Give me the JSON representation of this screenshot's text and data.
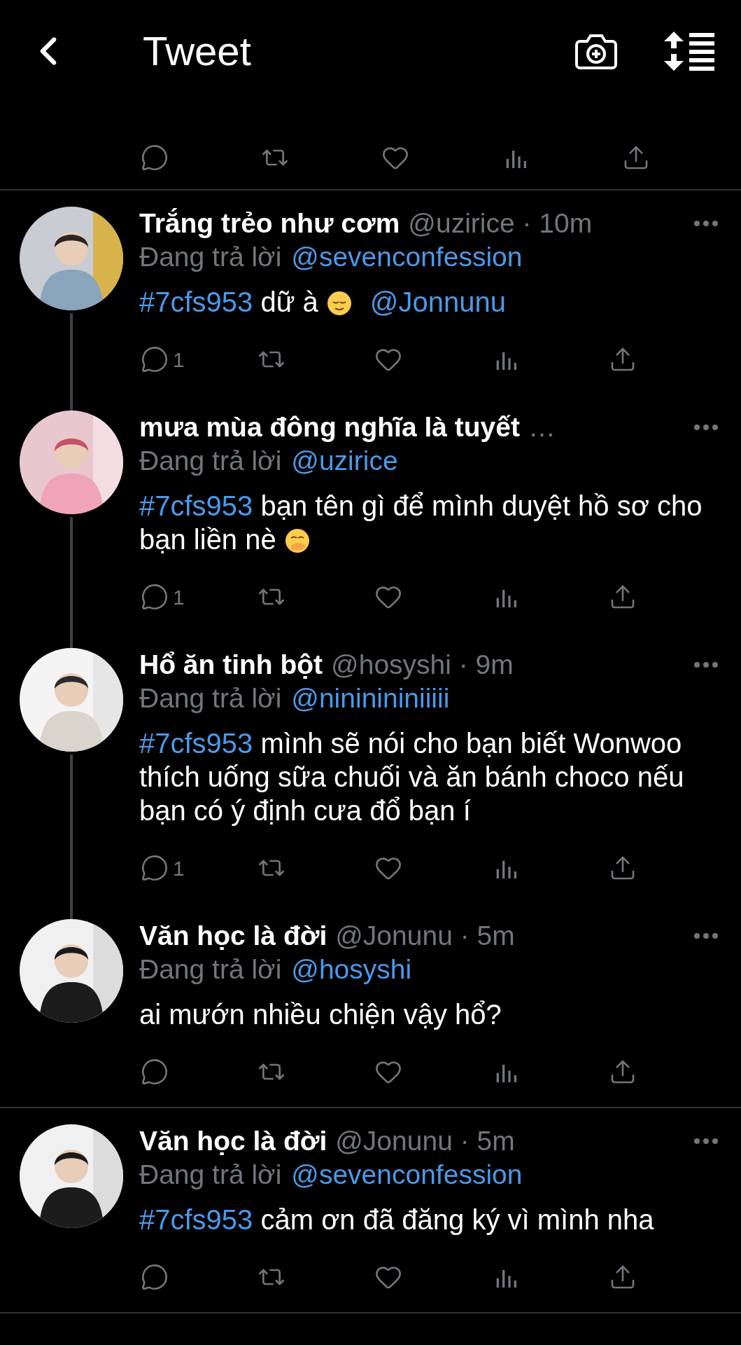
{
  "header": {
    "title": "Tweet"
  },
  "previous_tweet": {
    "actions": [
      {
        "kind": "reply"
      },
      {
        "kind": "retweet"
      },
      {
        "kind": "like"
      },
      {
        "kind": "views"
      },
      {
        "kind": "share"
      }
    ]
  },
  "tweets": [
    {
      "name": "Trắng trẻo như cơm",
      "meta": "@uzirice · 10m",
      "reply_label": "Đang trả lời",
      "reply_to": "@sevenconfession",
      "connects_below": true,
      "body": [
        {
          "kind": "hashtag",
          "text": "#7cfs953"
        },
        {
          "kind": "text",
          "text": " dữ à"
        },
        {
          "kind": "emoji_relieved"
        },
        {
          "kind": "mention",
          "text": "@Jonnunu"
        }
      ],
      "actions": [
        {
          "kind": "reply",
          "count": "1"
        },
        {
          "kind": "retweet"
        },
        {
          "kind": "like"
        },
        {
          "kind": "views"
        },
        {
          "kind": "share"
        }
      ]
    },
    {
      "name": "mưa mùa đông nghĩa là tuyết",
      "meta": "…",
      "reply_label": "Đang trả lời",
      "reply_to": "@uzirice",
      "connects_below": true,
      "body": [
        {
          "kind": "hashtag",
          "text": "#7cfs953"
        },
        {
          "kind": "text",
          "text": " bạn tên gì để mình duyệt hồ sơ cho bạn liền nè"
        },
        {
          "kind": "emoji_hand_over_mouth"
        }
      ],
      "actions": [
        {
          "kind": "reply",
          "count": "1"
        },
        {
          "kind": "retweet"
        },
        {
          "kind": "like"
        },
        {
          "kind": "views"
        },
        {
          "kind": "share"
        }
      ]
    },
    {
      "name": "Hổ ăn tinh bột",
      "meta": "@hosyshi · 9m",
      "reply_label": "Đang trả lời",
      "reply_to": "@nininininiiiii",
      "connects_below": true,
      "body": [
        {
          "kind": "hashtag",
          "text": "#7cfs953"
        },
        {
          "kind": "text",
          "text": " mình sẽ nói cho bạn biết Wonwoo thích uống sữa chuối và ăn bánh choco nếu bạn có ý định cưa đổ bạn í"
        }
      ],
      "actions": [
        {
          "kind": "reply",
          "count": "1"
        },
        {
          "kind": "retweet"
        },
        {
          "kind": "like"
        },
        {
          "kind": "views"
        },
        {
          "kind": "share"
        }
      ]
    },
    {
      "name": "Văn học là đời",
      "meta": "@Jonunu · 5m",
      "reply_label": "Đang trả lời",
      "reply_to": "@hosyshi",
      "connects_below": false,
      "body": [
        {
          "kind": "text",
          "text": "ai mướn nhiều chiện vậy hổ?"
        }
      ],
      "actions": [
        {
          "kind": "reply"
        },
        {
          "kind": "retweet"
        },
        {
          "kind": "like"
        },
        {
          "kind": "views"
        },
        {
          "kind": "share"
        }
      ]
    },
    {
      "name": "Văn học là đời",
      "meta": "@Jonunu · 5m",
      "reply_label": "Đang trả lời",
      "reply_to": "@sevenconfession",
      "connects_below": false,
      "body": [
        {
          "kind": "hashtag",
          "text": "#7cfs953"
        },
        {
          "kind": "text",
          "text": " cảm ơn đã đăng ký vì mình nha"
        }
      ],
      "actions": [
        {
          "kind": "reply"
        },
        {
          "kind": "retweet"
        },
        {
          "kind": "like"
        },
        {
          "kind": "views"
        },
        {
          "kind": "share"
        }
      ]
    }
  ]
}
